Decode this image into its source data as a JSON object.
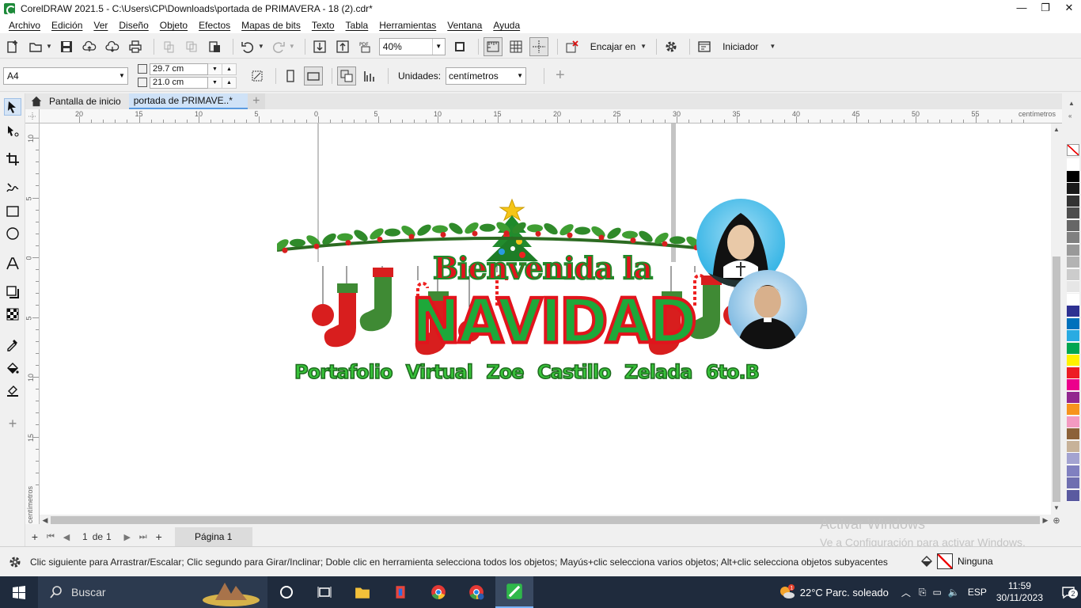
{
  "window": {
    "title": "CorelDRAW 2021.5 - C:\\Users\\CP\\Downloads\\portada de PRIMAVERA - 18 (2).cdr*",
    "minimize": "—",
    "restore": "❐",
    "close": "✕"
  },
  "menu": [
    "Archivo",
    "Edición",
    "Ver",
    "Diseño",
    "Objeto",
    "Efectos",
    "Mapas de bits",
    "Texto",
    "Tabla",
    "Herramientas",
    "Ventana",
    "Ayuda"
  ],
  "toolbar": {
    "zoom": "40%",
    "snap_label": "Encajar en",
    "launch_label": "Iniciador",
    "pdf_label": "PDF"
  },
  "propbar": {
    "page_size": "A4",
    "width": "29.7 cm",
    "height": "21.0 cm",
    "units_label": "Unidades:",
    "units": "centímetros"
  },
  "tabs": {
    "home": "Pantalla de inicio",
    "document": "portada de PRIMAVE..*"
  },
  "rulers": {
    "unit": "centímetros",
    "top_labels": [
      "20",
      "15",
      "10",
      "5",
      "0",
      "5",
      "10",
      "15",
      "20",
      "25",
      "30",
      "35",
      "40",
      "45",
      "50",
      "55"
    ],
    "left_labels": [
      "10",
      "5",
      "0",
      "5",
      "10",
      "15"
    ]
  },
  "artwork": {
    "line1": "Bienvenida la",
    "line2": "NAVIDAD",
    "line3": "Portafolio Virtual  Zoe Castillo Zelada  6to.B"
  },
  "pagenav": {
    "current": "1",
    "of": "de",
    "total": "1",
    "page_tab": "Página 1"
  },
  "watermark": {
    "line1": "Activar Windows",
    "line2": "Ve a Configuración para activar Windows."
  },
  "status": {
    "hint": "Clic siguiente para Arrastrar/Escalar; Clic segundo para Girar/Inclinar; Doble clic en herramienta selecciona todos los objetos; Mayús+clic selecciona varios objetos; Alt+clic selecciona objetos subyacentes",
    "fill": "Ninguna"
  },
  "taskbar": {
    "search": "Buscar",
    "weather": "22°C  Parc. soleado",
    "lang": "ESP",
    "time": "11:59",
    "date": "30/11/2023",
    "notif_count": "2",
    "weather_badge": "1"
  },
  "palette_colors": [
    "#ffffff",
    "#000000",
    "#1a1a1a",
    "#333333",
    "#4d4d4d",
    "#666666",
    "#808080",
    "#999999",
    "#b3b3b3",
    "#cccccc",
    "#e6e6e6",
    "#ffffff",
    "#2e3192",
    "#0071bc",
    "#29abe2",
    "#00a651",
    "#fff200",
    "#ed1c24",
    "#ec008c",
    "#92278f",
    "#f7941d",
    "#f49ac1",
    "#8c6239",
    "#c7b299",
    "#a3a3d1",
    "#8080c0",
    "#6f6fb0",
    "#5a5aa0"
  ]
}
